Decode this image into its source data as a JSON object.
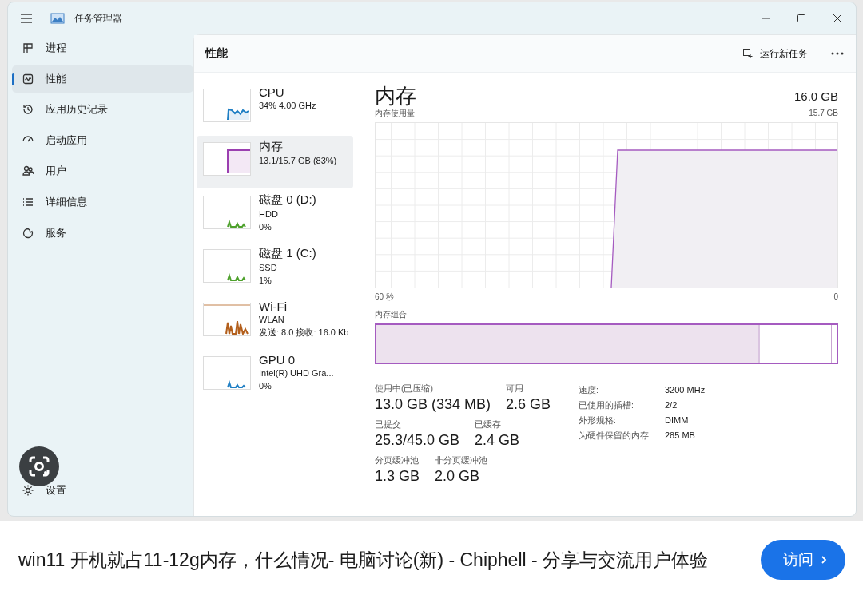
{
  "window": {
    "title": "任务管理器"
  },
  "nav": {
    "items": [
      {
        "label": "进程",
        "kind": "processes",
        "selected": false
      },
      {
        "label": "性能",
        "kind": "performance",
        "selected": true
      },
      {
        "label": "应用历史记录",
        "kind": "history",
        "selected": false
      },
      {
        "label": "启动应用",
        "kind": "startup",
        "selected": false
      },
      {
        "label": "用户",
        "kind": "users",
        "selected": false
      },
      {
        "label": "详细信息",
        "kind": "details",
        "selected": false
      },
      {
        "label": "服务",
        "kind": "services",
        "selected": false
      }
    ],
    "settings": {
      "label": "设置",
      "kind": "settings"
    }
  },
  "panel": {
    "title": "性能",
    "run_task": "运行新任务"
  },
  "devices": [
    {
      "kind": "cpu",
      "name": "CPU",
      "lines": [
        "34% 4.00 GHz"
      ],
      "color": "#1f7fc4",
      "selected": false
    },
    {
      "kind": "memory",
      "name": "内存",
      "lines": [
        "13.1/15.7 GB (83%)"
      ],
      "color": "#9b3fb0",
      "selected": true
    },
    {
      "kind": "disk",
      "name": "磁盘 0 (D:)",
      "lines": [
        "HDD",
        "0%"
      ],
      "color": "#4ea12c",
      "selected": false
    },
    {
      "kind": "disk",
      "name": "磁盘 1 (C:)",
      "lines": [
        "SSD",
        "1%"
      ],
      "color": "#4ea12c",
      "selected": false
    },
    {
      "kind": "wifi",
      "name": "Wi-Fi",
      "lines": [
        "WLAN",
        "发送: 8.0 接收: 16.0 Kb"
      ],
      "color": "#b35f1c",
      "selected": false
    },
    {
      "kind": "gpu",
      "name": "GPU 0",
      "lines": [
        "Intel(R) UHD Gra...",
        "0%"
      ],
      "color": "#1f7fc4",
      "selected": false
    }
  ],
  "detail": {
    "title": "内存",
    "capacity": "16.0 GB",
    "usage_label": "内存使用量",
    "usage_max": "15.7 GB",
    "x_start": "60 秒",
    "x_end": "0",
    "composition_label": "内存组合",
    "composition": {
      "level": 0.83
    },
    "stats": [
      [
        {
          "label": "使用中(已压缩)",
          "value": "13.0 GB (334 MB)"
        },
        {
          "label": "可用",
          "value": "2.6 GB"
        }
      ],
      [
        {
          "label": "已提交",
          "value": "25.3/45.0 GB"
        },
        {
          "label": "已缓存",
          "value": "2.4 GB"
        }
      ],
      [
        {
          "label": "分页缓冲池",
          "value": "1.3 GB"
        },
        {
          "label": "非分页缓冲池",
          "value": "2.0 GB"
        }
      ]
    ],
    "specs": [
      {
        "label": "速度:",
        "value": "3200 MHz"
      },
      {
        "label": "已使用的插槽:",
        "value": "2/2"
      },
      {
        "label": "外形规格:",
        "value": "DIMM"
      },
      {
        "label": "为硬件保留的内存:",
        "value": "285 MB"
      }
    ]
  },
  "result": {
    "title": "win11 开机就占11-12g内存，什么情况- 电脑讨论(新) - Chiphell - 分享与交流用户体验",
    "visit": "访问"
  }
}
